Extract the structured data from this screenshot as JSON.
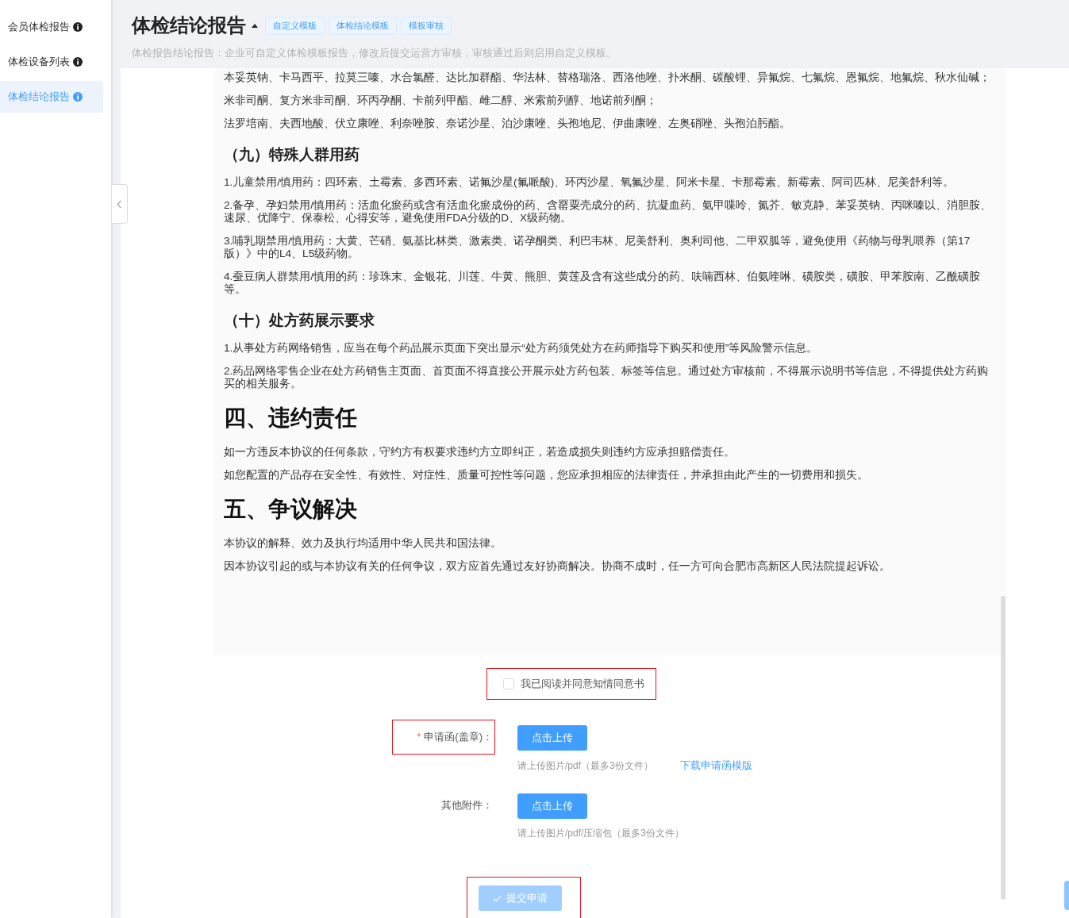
{
  "sidebar": {
    "items": [
      {
        "label": "会员体检报告",
        "selected": false
      },
      {
        "label": "体检设备列表",
        "selected": false
      },
      {
        "label": "体检结论报告",
        "selected": true
      }
    ]
  },
  "header": {
    "title": "体检结论报告",
    "tags": [
      "自定义模板",
      "体检结论模板",
      "模板审核"
    ],
    "description": "体检报告结论报告：企业可自定义体检模板报告，修改后提交运营方审核，审核通过后则启用自定义模板。"
  },
  "document": {
    "blocks": [
      {
        "kind": "paragraph",
        "text": "本妥英钠、卡马西平、拉莫三嗪、水合氯醛、达比加群酯、华法林、替格瑞洛、西洛他唑、扑米酮、碳酸锂、异氟烷、七氟烷、恩氟烷、地氟烷、秋水仙碱；"
      },
      {
        "kind": "paragraph",
        "text": "米非司酮、复方米非司酮、环丙孕酮、卡前列甲酯、雌二醇、米索前列醇、地诺前列酮；"
      },
      {
        "kind": "paragraph",
        "text": "法罗培南、夫西地酸、伏立康唑、利奈唑胺、奈诺沙星、泊沙康唑、头孢地尼、伊曲康唑、左奥硝唑、头孢泊肟酯。"
      },
      {
        "kind": "subheading",
        "text": "（九）特殊人群用药"
      },
      {
        "kind": "paragraph",
        "text": "1.儿童禁用/慎用药：四环素、土霉素、多西环素、诺氟沙星(氟哌酸)、环丙沙星、氧氟沙星、阿米卡星、卡那霉素、新霉素、阿司匹林、尼美舒利等。"
      },
      {
        "kind": "paragraph",
        "text": "2.备孕、孕妇禁用/慎用药：活血化瘀药或含有活血化瘀成份的药、含罂粟壳成分的药、抗凝血药、氨甲喋呤、氮芥、敏克静、苯妥英钠、丙咪嗪以、消胆胺、速尿、优降宁、保泰松、心得安等，避免使用FDA分级的D、X级药物。"
      },
      {
        "kind": "paragraph",
        "text": "3.哺乳期禁用/慎用药：大黄、芒硝、氨基比林类、激素类、诺孕酮类、利巴韦林、尼美舒利、奥利司他、二甲双胍等，避免使用《药物与母乳喂养（第17版）》中的L4、L5级药物。"
      },
      {
        "kind": "paragraph",
        "text": "4.蚕豆病人群禁用/慎用的药：珍珠末、金银花、川莲、牛黄、熊胆、黄莲及含有这些成分的药、呋喃西林、伯氨喹啉、磺胺类，磺胺、甲苯胺南、乙酰磺胺等。"
      },
      {
        "kind": "subheading",
        "text": "（十）处方药展示要求"
      },
      {
        "kind": "paragraph",
        "text": "1.从事处方药网络销售，应当在每个药品展示页面下突出显示“处方药须凭处方在药师指导下购买和使用”等风险警示信息。"
      },
      {
        "kind": "paragraph",
        "text": "2.药品网络零售企业在处方药销售主页面、首页面不得直接公开展示处方药包装、标签等信息。通过处方审核前，不得展示说明书等信息，不得提供处方药购买的相关服务。"
      },
      {
        "kind": "heading",
        "text": "四、违约责任"
      },
      {
        "kind": "paragraph",
        "text": "如一方违反本协议的任何条款，守约方有权要求违约方立即纠正，若造成损失则违约方应承担赔偿责任。"
      },
      {
        "kind": "paragraph",
        "text": "如您配置的产品存在安全性、有效性、对症性、质量可控性等问题，您应承担相应的法律责任，并承担由此产生的一切费用和损失。"
      },
      {
        "kind": "heading",
        "text": "五、争议解决"
      },
      {
        "kind": "paragraph",
        "text": "本协议的解释、效力及执行均适用中华人民共和国法律。"
      },
      {
        "kind": "paragraph",
        "text": "因本协议引起的或与本协议有关的任何争议，双方应首先通过友好协商解决。协商不成时，任一方可向合肥市高新区人民法院提起诉讼。"
      }
    ]
  },
  "consent": {
    "label": "我已阅读并同意知情同意书",
    "checked": false,
    "highlighted": true
  },
  "upload_fields": [
    {
      "label": "申请函(盖章)：",
      "required_mark": "*",
      "highlighted": true,
      "button": "点击上传",
      "hint": "请上传图片/pdf（最多3份文件）",
      "link": "下载申请函模版"
    },
    {
      "label": "其他附件：",
      "highlighted": false,
      "button": "点击上传",
      "hint": "请上传图片/pdf/压缩包（最多3份文件）"
    }
  ],
  "submit": {
    "label": "提交申请",
    "disabled": true,
    "highlighted": true
  }
}
